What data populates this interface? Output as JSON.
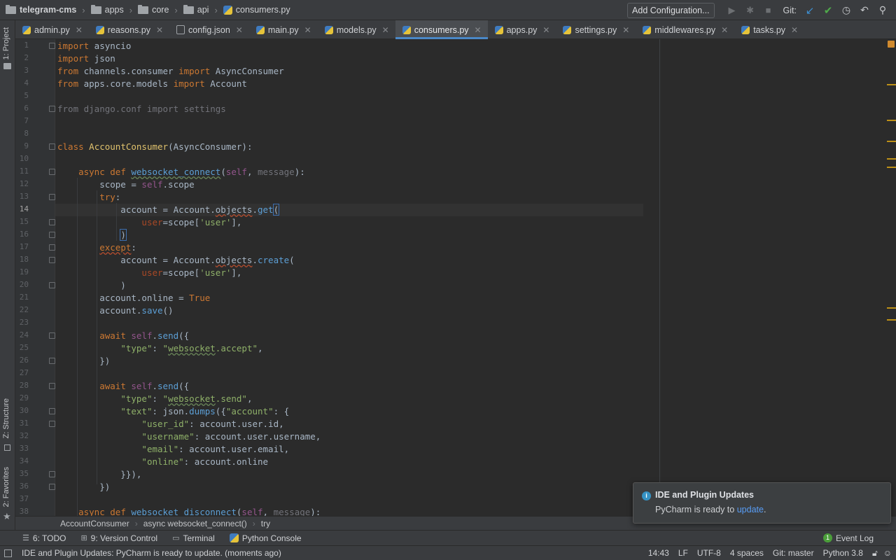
{
  "navbar": {
    "crumbs": [
      "telegram-cms",
      "apps",
      "core",
      "api",
      "consumers.py"
    ],
    "add_configuration": "Add Configuration...",
    "git_label": "Git:"
  },
  "left_strip": {
    "project": "1: Project",
    "structure": "Z: Structure",
    "favorites": "2: Favorites"
  },
  "tabs": [
    {
      "label": "admin.py"
    },
    {
      "label": "reasons.py"
    },
    {
      "label": "config.json"
    },
    {
      "label": "main.py"
    },
    {
      "label": "models.py"
    },
    {
      "label": "consumers.py",
      "active": true
    },
    {
      "label": "apps.py"
    },
    {
      "label": "settings.py"
    },
    {
      "label": "middlewares.py"
    },
    {
      "label": "tasks.py"
    }
  ],
  "code": {
    "line_numbers": [
      "1",
      "2",
      "3",
      "4",
      "5",
      "6",
      "7",
      "8",
      "9",
      "10",
      "11",
      "12",
      "13",
      "14",
      "15",
      "16",
      "17",
      "18",
      "19",
      "20",
      "21",
      "22",
      "23",
      "24",
      "25",
      "26",
      "27",
      "28",
      "29",
      "30",
      "31",
      "32",
      "33",
      "34",
      "35",
      "36",
      "37",
      "38"
    ],
    "current_line": "14"
  },
  "breadcrumb": [
    "AccountConsumer",
    "async websocket_connect()",
    "try"
  ],
  "toolwindows": {
    "todo": "6: TODO",
    "vcs": "9: Version Control",
    "terminal": "Terminal",
    "console": "Python Console",
    "event_log": "Event Log",
    "event_count": "1"
  },
  "status": {
    "message": "IDE and Plugin Updates: PyCharm is ready to update. (moments ago)",
    "position": "14:43",
    "line_sep": "LF",
    "encoding": "UTF-8",
    "indent": "4 spaces",
    "branch": "Git: master",
    "interpreter": "Python 3.8"
  },
  "popup": {
    "title": "IDE and Plugin Updates",
    "body_prefix": "PyCharm is ready to ",
    "link": "update",
    "body_suffix": "."
  },
  "colors": {
    "accent": "#4a88c7",
    "keyword": "#cc7832",
    "string": "#8fb169",
    "function": "#5c9fd6",
    "marker": "#be9117"
  }
}
